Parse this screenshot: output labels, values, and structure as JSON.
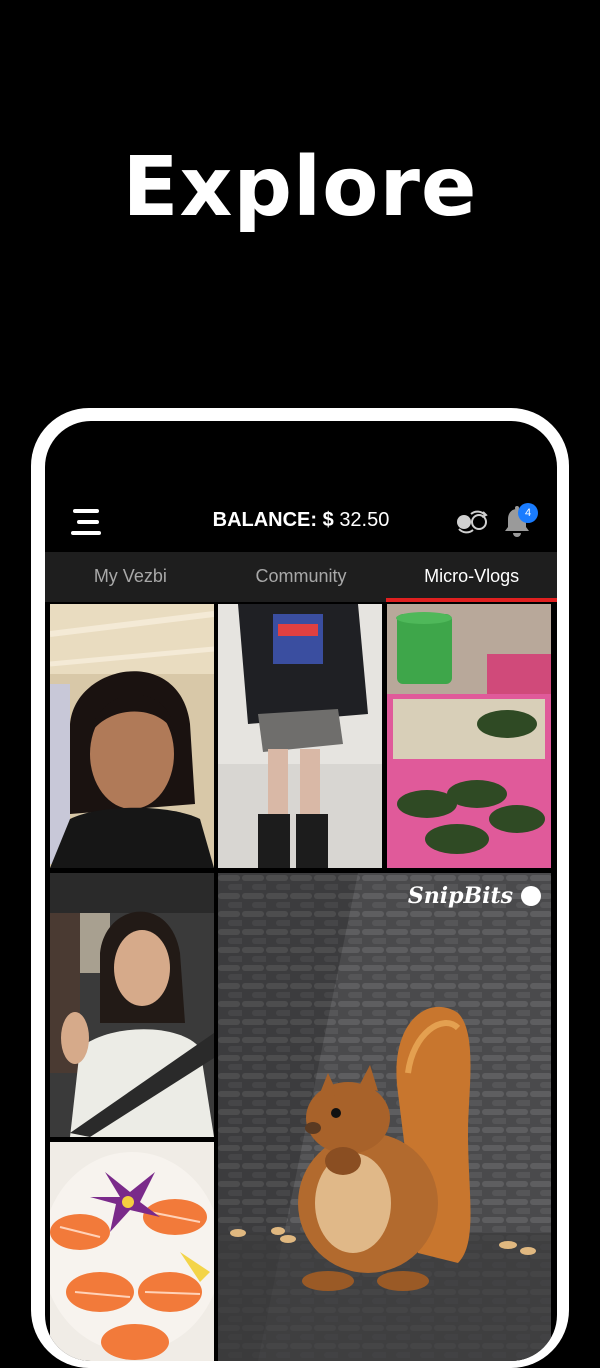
{
  "hero": {
    "title": "Explore"
  },
  "header": {
    "balance_label": "BALANCE:",
    "currency": "$",
    "balance_value": "32.50",
    "notification_count": "4"
  },
  "tabs": [
    {
      "label": "My Vezbi"
    },
    {
      "label": "Community"
    },
    {
      "label": "Micro-Vlogs"
    }
  ],
  "feed": {
    "brand_watermark": "SnipBits"
  },
  "colors": {
    "accent_red": "#e02020",
    "badge_blue": "#1a7cff",
    "tab_bar_bg": "#1e1e1e"
  }
}
